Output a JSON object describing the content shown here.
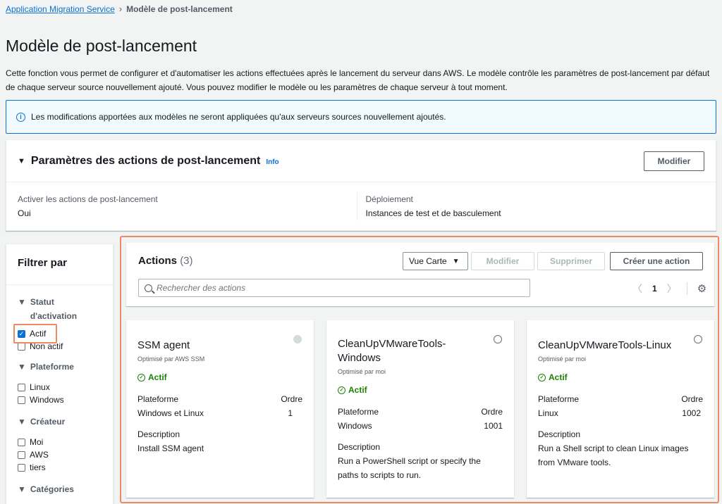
{
  "breadcrumb": {
    "root": "Application Migration Service",
    "current": "Modèle de post-lancement"
  },
  "page": {
    "title": "Modèle de post-lancement",
    "description": "Cette fonction vous permet de configurer et d'automatiser les actions effectuées après le lancement du serveur dans AWS. Le modèle contrôle les paramètres de post-lancement par défaut de chaque serveur source nouvellement ajouté. Vous pouvez modifier le modèle ou les paramètres de chaque serveur à tout moment."
  },
  "alert": {
    "text": "Les modifications apportées aux modèles ne seront appliquées qu'aux serveurs sources nouvellement ajoutés."
  },
  "params": {
    "title": "Paramètres des actions de post-lancement",
    "info": "Info",
    "edit_label": "Modifier",
    "activate_label": "Activer les actions de post-lancement",
    "activate_value": "Oui",
    "deploy_label": "Déploiement",
    "deploy_value": "Instances de test et de basculement"
  },
  "filter": {
    "title": "Filtrer par",
    "status_head": "Statut d'activation",
    "status_opts": [
      "Actif",
      "Non actif"
    ],
    "platform_head": "Plateforme",
    "platform_opts": [
      "Linux",
      "Windows"
    ],
    "creator_head": "Créateur",
    "creator_opts": [
      "Moi",
      "AWS",
      "tiers"
    ],
    "category_head": "Catégories"
  },
  "actions": {
    "title": "Actions",
    "count": "(3)",
    "view_label": "Vue Carte",
    "modify_label": "Modifier",
    "delete_label": "Supprimer",
    "create_label": "Créer une action",
    "search_placeholder": "Rechercher des actions",
    "page": "1"
  },
  "cards": [
    {
      "name": "SSM agent",
      "sub": "Optimisé par AWS SSM",
      "status": "Actif",
      "platform_label": "Plateforme",
      "order_label": "Ordre",
      "platform": "Windows et Linux",
      "order": "1",
      "desc_label": "Description",
      "desc": "Install SSM agent"
    },
    {
      "name": "CleanUpVMwareTools-Windows",
      "sub": "Optimisé par moi",
      "status": "Actif",
      "platform_label": "Plateforme",
      "order_label": "Ordre",
      "platform": "Windows",
      "order": "1001",
      "desc_label": "Description",
      "desc": "Run a PowerShell script or specify the paths to scripts to run."
    },
    {
      "name": "CleanUpVMwareTools-Linux",
      "sub": "Optimisé par moi",
      "status": "Actif",
      "platform_label": "Plateforme",
      "order_label": "Ordre",
      "platform": "Linux",
      "order": "1002",
      "desc_label": "Description",
      "desc": "Run a Shell script to clean Linux images from VMware tools."
    }
  ]
}
